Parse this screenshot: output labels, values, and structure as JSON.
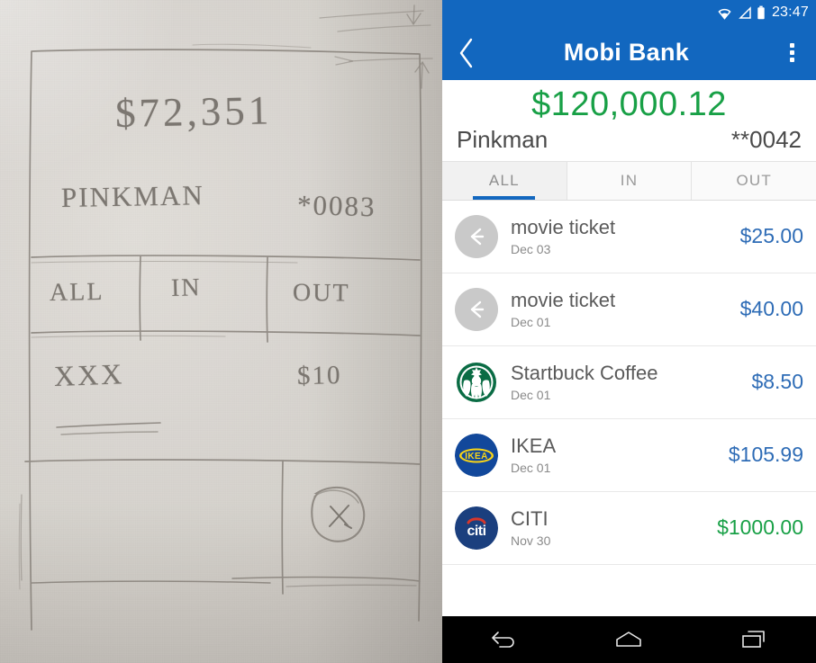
{
  "sketch": {
    "amount": "$72,351",
    "name": "PINKMAN",
    "account": "*0083",
    "tab_all": "ALL",
    "tab_in": "IN",
    "tab_out": "OUT",
    "row_placeholder": "XXX",
    "row_amount": "$10",
    "close_mark": "X"
  },
  "phone": {
    "statusbar": {
      "wifi_icon": "wifi-icon",
      "signal_icon": "signal-icon",
      "battery_icon": "battery-icon",
      "time": "23:47"
    },
    "appbar": {
      "back_icon": "chevron-left-icon",
      "title": "Mobi Bank",
      "overflow_icon": "overflow-menu-icon"
    },
    "account": {
      "balance": "$120,000.12",
      "name": "Pinkman",
      "number": "**0042"
    },
    "tabs": [
      {
        "label": "ALL",
        "active": true
      },
      {
        "label": "IN",
        "active": false
      },
      {
        "label": "OUT",
        "active": false
      }
    ],
    "transactions": [
      {
        "title": "movie ticket",
        "date": "Dec 03",
        "amount": "$25.00",
        "direction": "out",
        "logo": "arrow-left-icon"
      },
      {
        "title": "movie ticket",
        "date": "Dec 01",
        "amount": "$40.00",
        "direction": "out",
        "logo": "arrow-left-icon"
      },
      {
        "title": "Startbuck Coffee",
        "date": "Dec 01",
        "amount": "$8.50",
        "direction": "out",
        "logo": "starbucks-logo"
      },
      {
        "title": "IKEA",
        "date": "Dec 01",
        "amount": "$105.99",
        "direction": "out",
        "logo": "ikea-logo"
      },
      {
        "title": "CITI",
        "date": "Nov 30",
        "amount": "$1000.00",
        "direction": "in",
        "logo": "citi-logo"
      }
    ],
    "navbar": [
      {
        "icon": "back-nav-icon"
      },
      {
        "icon": "home-nav-icon"
      },
      {
        "icon": "recents-nav-icon"
      }
    ],
    "colors": {
      "brand_blue": "#1267bf",
      "credit_green": "#18a046",
      "debit_blue": "#2e6cb6"
    }
  }
}
